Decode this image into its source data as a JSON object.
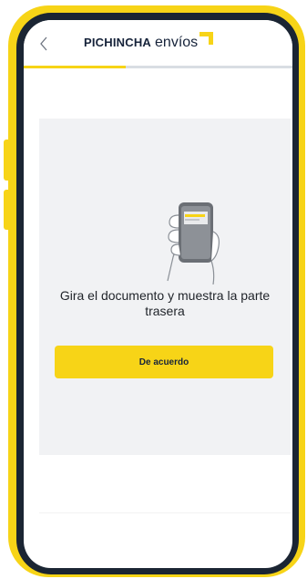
{
  "header": {
    "brand_strong": "PICHINCHA",
    "brand_light": "envíos",
    "back_icon": "chevron-left-icon"
  },
  "progress": {
    "fraction": 0.38,
    "fill_color": "#f7d417"
  },
  "content": {
    "instruction_line1": "Gira el documento y muestra la parte",
    "instruction_line2": "trasera",
    "illustration_icon": "hand-holding-phone-icon",
    "agree_label": "De acuerdo"
  },
  "colors": {
    "accent": "#f7d417",
    "brand_text": "#16233a",
    "frame": "#1b2533",
    "card_bg": "#f1f2f4"
  }
}
